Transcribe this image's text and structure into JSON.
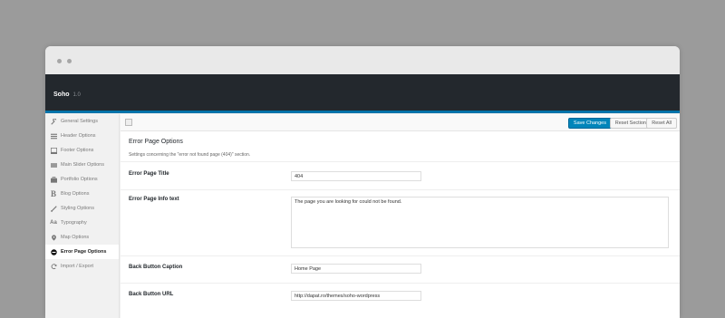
{
  "app": {
    "name": "Soho",
    "version": "1.0"
  },
  "sidebar": {
    "items": [
      {
        "label": "General Settings",
        "icon": "wrench-icon"
      },
      {
        "label": "Header Options",
        "icon": "menu-icon"
      },
      {
        "label": "Footer Options",
        "icon": "footer-icon"
      },
      {
        "label": "Main Slider Options",
        "icon": "slider-icon"
      },
      {
        "label": "Portfolio Options",
        "icon": "portfolio-icon"
      },
      {
        "label": "Blog Options",
        "icon": "blog-icon"
      },
      {
        "label": "Styling Options",
        "icon": "brush-icon"
      },
      {
        "label": "Typography",
        "icon": "typography-icon"
      },
      {
        "label": "Map Options",
        "icon": "map-pin-icon"
      },
      {
        "label": "Error Page Options",
        "icon": "minus-circle-icon",
        "active": true
      },
      {
        "label": "Import / Export",
        "icon": "refresh-icon"
      }
    ]
  },
  "toolbar": {
    "save_label": "Save Changes",
    "reset_section_label": "Reset Section",
    "reset_all_label": "Reset All"
  },
  "section": {
    "title": "Error Page Options",
    "description": "Settings concerning the \"error not found page (404)\" section."
  },
  "fields": {
    "error_title": {
      "label": "Error Page Title",
      "value": "404"
    },
    "error_info": {
      "label": "Error Page Info text",
      "value": "The page you are looking for could not be found."
    },
    "back_caption": {
      "label": "Back Button Caption",
      "value": "Home Page"
    },
    "back_url": {
      "label": "Back Button URL",
      "value": "http://dapat.ro/themes/soho-wordpress"
    }
  },
  "colors": {
    "header_bg": "#23282d",
    "accent": "#0073aa",
    "primary_button": "#0085ba"
  }
}
